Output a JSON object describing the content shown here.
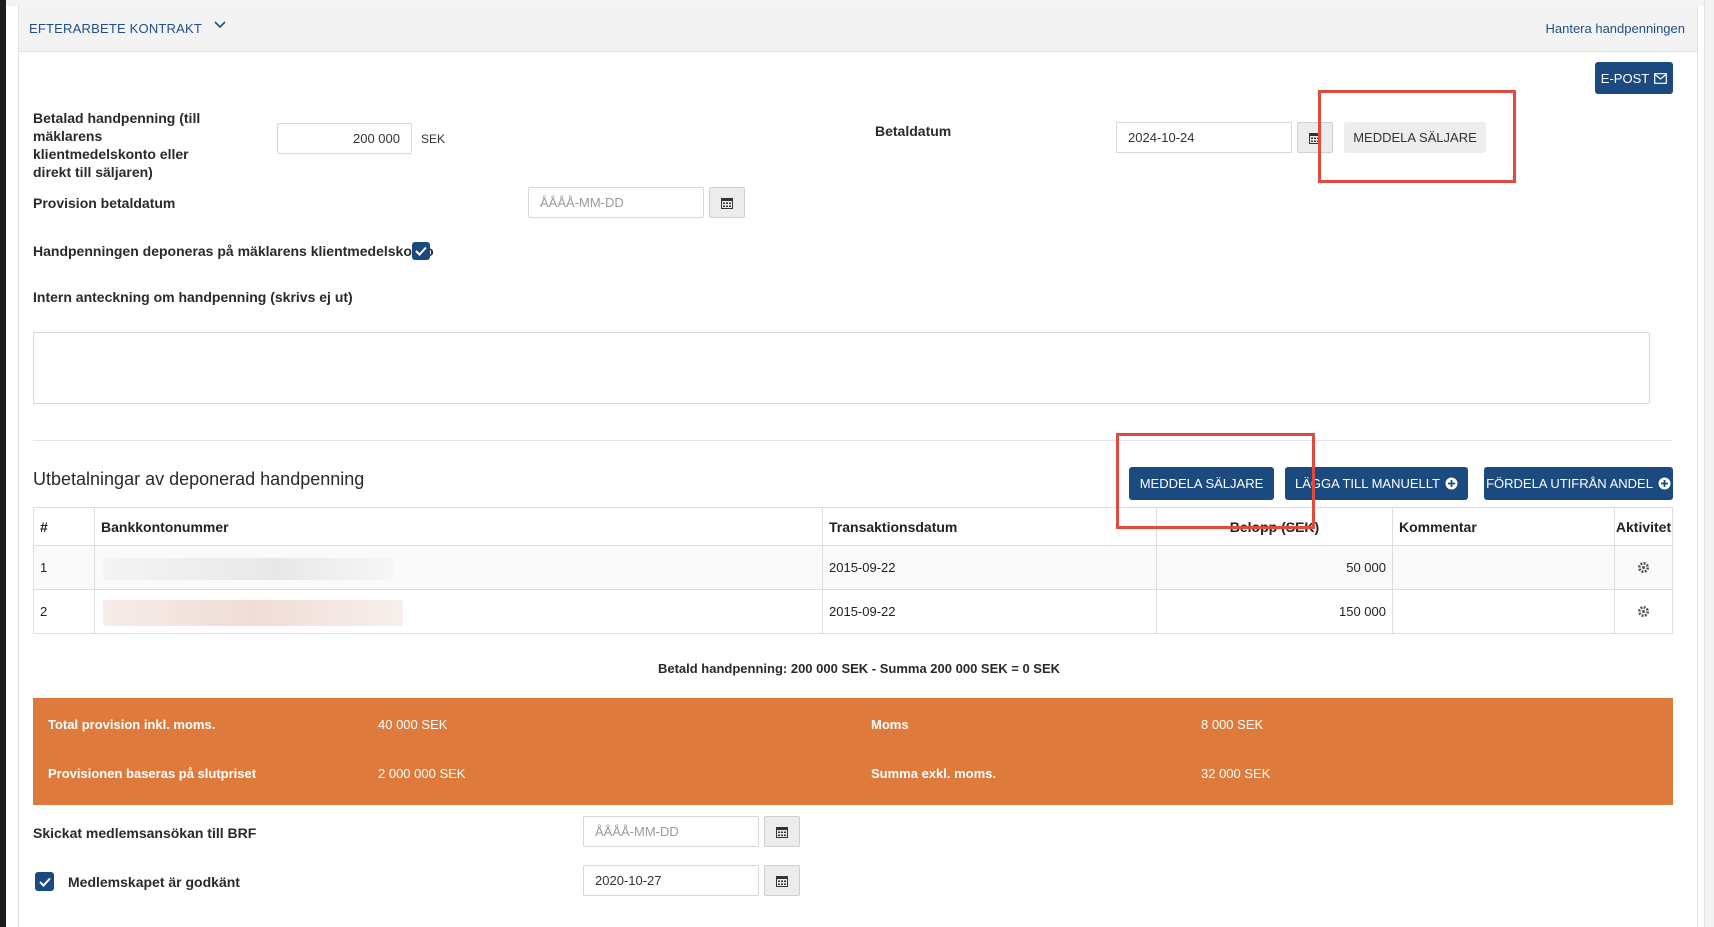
{
  "header": {
    "title": "EFTERARBETE KONTRAKT",
    "link": "Hantera handpenningen"
  },
  "email_button": "E-POST",
  "deposit": {
    "paid_label": "Betalad handpenning (till mäklarens klientmedelskonto eller direkt till säljaren)",
    "paid_value": "200 000",
    "paid_unit": "SEK",
    "pay_date_label": "Betaldatum",
    "pay_date_value": "2024-10-24",
    "notify_seller": "MEDDELA SÄLJARE",
    "commission_date_label": "Provision betaldatum",
    "commission_date_placeholder": "ÅÅÅÅ-MM-DD",
    "deposited_label": "Handpenningen deponeras på mäklarens klientmedelskonto",
    "deposited_checked": true,
    "note_label": "Intern anteckning om handpenning (skrivs ej ut)",
    "note_value": ""
  },
  "payouts": {
    "title": "Utbetalningar av deponerad handpenning",
    "buttons": {
      "notify": "MEDDELA SÄLJARE",
      "add_manual": "LÄGGA TILL MANUELLT",
      "distribute": "FÖRDELA UTIFRÅN ANDEL"
    },
    "columns": [
      "#",
      "Bankkontonummer",
      "Transaktionsdatum",
      "Belopp (SEK)",
      "Kommentar",
      "Aktivitet"
    ],
    "rows": [
      {
        "index": "1",
        "account": "",
        "date": "2015-09-22",
        "amount": "50 000",
        "comment": ""
      },
      {
        "index": "2",
        "account": "",
        "date": "2015-09-22",
        "amount": "150 000",
        "comment": ""
      }
    ],
    "summary": "Betald handpenning: 200 000 SEK - Summa 200 000 SEK = 0 SEK"
  },
  "commission": {
    "total_label": "Total provision inkl. moms.",
    "total_value": "40 000 SEK",
    "vat_label": "Moms",
    "vat_value": "8 000 SEK",
    "based_label": "Provisionen baseras på slutpriset",
    "based_value": "2 000 000 SEK",
    "excl_label": "Summa exkl. moms.",
    "excl_value": "32 000 SEK"
  },
  "membership": {
    "sent_label": "Skickat medlemsansökan till BRF",
    "sent_placeholder": "ÅÅÅÅ-MM-DD",
    "approved_label": "Medlemskapet är godkänt",
    "approved_checked": true,
    "approved_date": "2020-10-27"
  },
  "colors": {
    "primary": "#1b4a80",
    "orange": "#de7b3c",
    "highlight": "#e04b40"
  }
}
